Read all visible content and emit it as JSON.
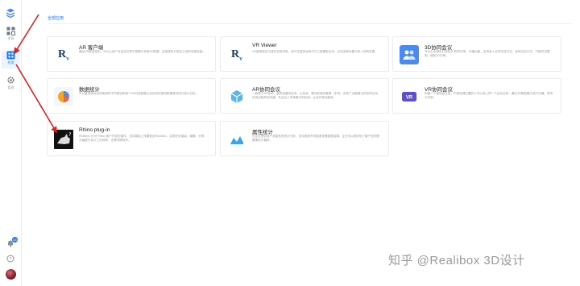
{
  "sidebar": {
    "items": [
      {
        "label": "发现"
      },
      {
        "label": "应用"
      },
      {
        "label": "管理"
      }
    ],
    "notification_count": "48"
  },
  "main": {
    "tab_label": "全部应用",
    "cards": [
      {
        "title": "AR 客户端",
        "desc": "通过AR增强现实，可以让用户在真实世界中观看与体验3D数据，实现虚拟与现实之间的完美连接。"
      },
      {
        "title": "VR Viewer",
        "desc": "VR虚拟现实沉浸式浏览体验，用户在虚拟空间中与三维模型互动，支持多种设备与多人协同查看。"
      },
      {
        "title": "3D协同会议",
        "desc": "专为企业团队打造的3D协同评审、沟通功能，支持多人实时在线讨论，多种互动方式，打破时空限制，轻松3D评审。"
      },
      {
        "title": "数据统计",
        "desc": "可以直观地对应用使用的不同类目和每个3D内容数据以及应用的使用数据情况进行统计分析。"
      },
      {
        "title": "AR协同会议",
        "desc": "一款基于AR技术、高质量通讯技术、云技术、移动终端设备等（手机）实现了远程展示的协同互动，实现远程异地沟通、在企业工作场景中的应用，让合作更加高效。"
      },
      {
        "title": "VR协同会议",
        "desc": "构建一个虚拟会议室，不受地理位置的人可以进入同一个会议空间，通过3D数据展示进行沟通、协同与评审。"
      },
      {
        "title": "Rhino plug-in",
        "desc": "Realibox 针对 Rhino 用户开发的插件，支持直接上传模型至Realibox，实现在线渲染、编辑、分享，大幅提升设计工作效率，无需切换软件。"
      },
      {
        "title": "属性统计",
        "desc": "为企业提供对产品属性的统计分析，支持按照不同维度查看数据结果，企业可以更好地了解产品的配置情况与偏好。"
      }
    ]
  },
  "watermark": "知乎 @Realibox 3D设计"
}
